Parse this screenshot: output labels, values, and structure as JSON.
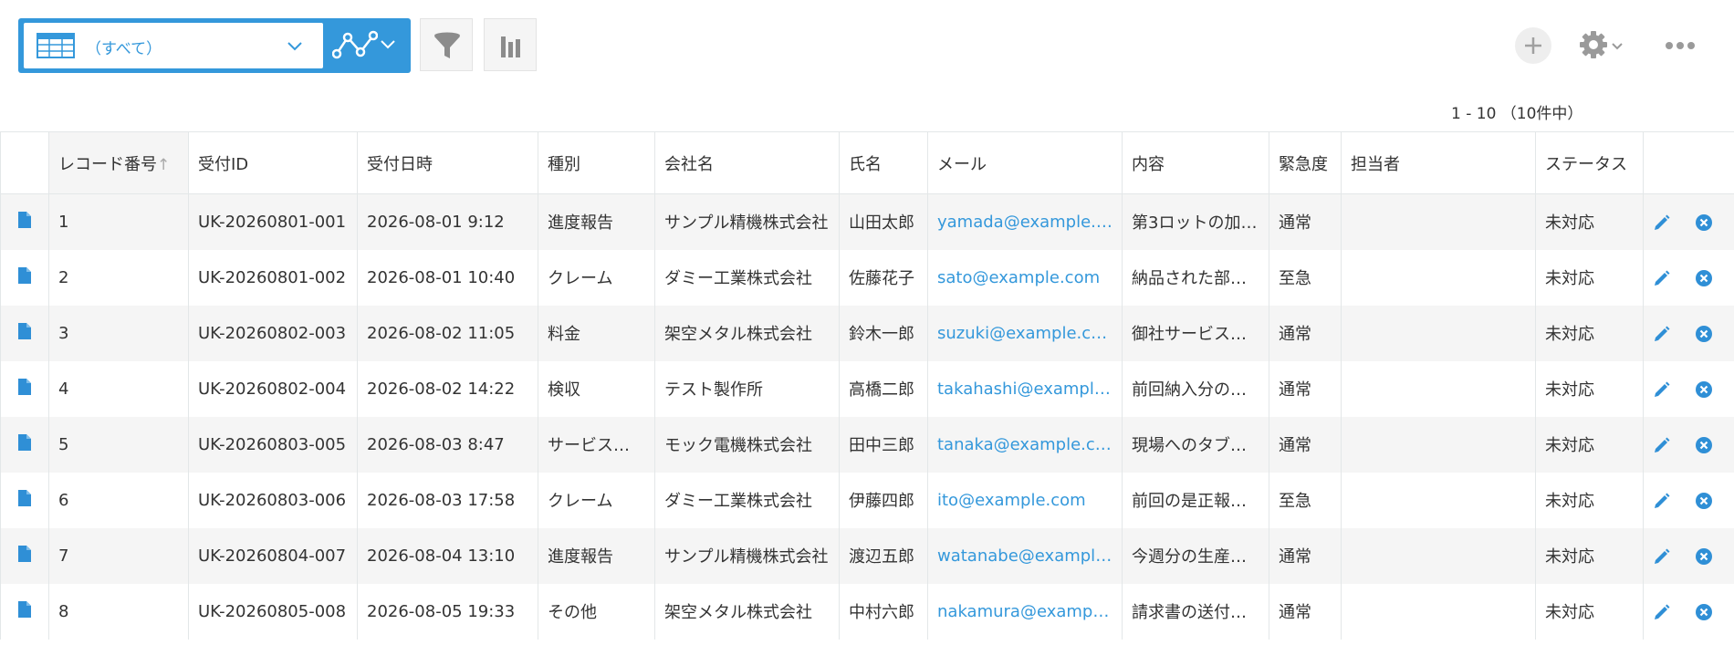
{
  "toolbar": {
    "view_label": "（すべて）",
    "icons": {
      "view": "table-icon",
      "graph": "line-graph-icon",
      "filter": "funnel-icon",
      "chart": "bar-chart-icon",
      "add": "plus-icon",
      "settings": "gear-icon",
      "more": "more-icon"
    },
    "accent_color": "#3498db"
  },
  "pager": {
    "text": "1 - 10 （10件中）"
  },
  "table": {
    "columns": [
      "",
      "レコード番号",
      "受付ID",
      "受付日時",
      "種別",
      "会社名",
      "氏名",
      "メール",
      "内容",
      "緊急度",
      "担当者",
      "ステータス",
      ""
    ],
    "sort_indicator": "↑",
    "rows": [
      {
        "no": "1",
        "id": "UK-20260801-001",
        "datetime": "2026-08-01 9:12",
        "type": "進度報告",
        "company": "サンプル精機株式会社",
        "name": "山田太郎",
        "mail": "yamada@example.c…",
        "content": "第3ロットの加…",
        "urgency": "通常",
        "assignee": "",
        "status": "未対応"
      },
      {
        "no": "2",
        "id": "UK-20260801-002",
        "datetime": "2026-08-01 10:40",
        "type": "クレーム",
        "company": "ダミー工業株式会社",
        "name": "佐藤花子",
        "mail": "sato@example.com",
        "content": "納品された部品…",
        "urgency": "至急",
        "assignee": "",
        "status": "未対応"
      },
      {
        "no": "3",
        "id": "UK-20260802-003",
        "datetime": "2026-08-02 11:05",
        "type": "料金",
        "company": "架空メタル株式会社",
        "name": "鈴木一郎",
        "mail": "suzuki@example.com",
        "content": "御社サービスの…",
        "urgency": "通常",
        "assignee": "",
        "status": "未対応"
      },
      {
        "no": "4",
        "id": "UK-20260802-004",
        "datetime": "2026-08-02 14:22",
        "type": "検収",
        "company": "テスト製作所",
        "name": "高橋二郎",
        "mail": "takahashi@example.…",
        "content": "前回納入分の検…",
        "urgency": "通常",
        "assignee": "",
        "status": "未対応"
      },
      {
        "no": "5",
        "id": "UK-20260803-005",
        "datetime": "2026-08-03 8:47",
        "type": "サービス導入",
        "company": "モック電機株式会社",
        "name": "田中三郎",
        "mail": "tanaka@example.com",
        "content": "現場へのタブレ…",
        "urgency": "通常",
        "assignee": "",
        "status": "未対応"
      },
      {
        "no": "6",
        "id": "UK-20260803-006",
        "datetime": "2026-08-03 17:58",
        "type": "クレーム",
        "company": "ダミー工業株式会社",
        "name": "伊藤四郎",
        "mail": "ito@example.com",
        "content": "前回の是正報告…",
        "urgency": "至急",
        "assignee": "",
        "status": "未対応"
      },
      {
        "no": "7",
        "id": "UK-20260804-007",
        "datetime": "2026-08-04 13:10",
        "type": "進度報告",
        "company": "サンプル精機株式会社",
        "name": "渡辺五郎",
        "mail": "watanabe@example…",
        "content": "今週分の生産進…",
        "urgency": "通常",
        "assignee": "",
        "status": "未対応"
      },
      {
        "no": "8",
        "id": "UK-20260805-008",
        "datetime": "2026-08-05 19:33",
        "type": "その他",
        "company": "架空メタル株式会社",
        "name": "中村六郎",
        "mail": "nakamura@example…",
        "content": "請求書の送付先…",
        "urgency": "通常",
        "assignee": "",
        "status": "未対応"
      }
    ]
  }
}
